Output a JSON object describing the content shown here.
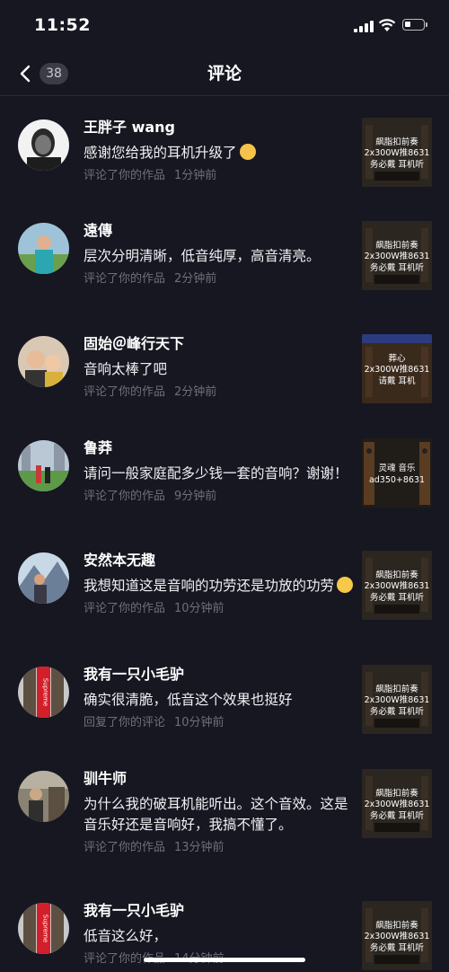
{
  "status_bar": {
    "time": "11:52"
  },
  "nav": {
    "title": "评论",
    "count": "38"
  },
  "comments": [
    {
      "username": "王胖子 wang",
      "text": "感谢您给我的耳机升级了",
      "emoji": "thinking-face",
      "meta_action": "评论了你的作品",
      "time": "1分钟前",
      "thumb_lines": [
        "飙脂扣前奏",
        "2x300W推8631",
        "务必戴  耳机听"
      ]
    },
    {
      "username": "遠傳",
      "text": "层次分明清晰，低音纯厚，高音清亮。",
      "emoji": "",
      "meta_action": "评论了你的作品",
      "time": "2分钟前",
      "thumb_lines": [
        "飙脂扣前奏",
        "2x300W推8631",
        "务必戴  耳机听"
      ]
    },
    {
      "username": "固始＠峰行天下",
      "text": "音响太棒了吧",
      "emoji": "",
      "meta_action": "评论了你的作品",
      "time": "2分钟前",
      "thumb_lines": [
        "葬心",
        "2x300W推8631",
        "请戴  耳机"
      ]
    },
    {
      "username": "鲁莽",
      "text": "请问一般家庭配多少钱一套的音响？谢谢！",
      "emoji": "",
      "meta_action": "评论了你的作品",
      "time": "9分钟前",
      "thumb_lines": [
        "灵魂  音乐",
        "ad350+8631"
      ]
    },
    {
      "username": "安然本无趣",
      "text": "我想知道这是音响的功劳还是功放的功劳",
      "emoji": "laughing-face",
      "meta_action": "评论了你的作品",
      "time": "10分钟前",
      "thumb_lines": [
        "飙脂扣前奏",
        "2x300W推8631",
        "务必戴  耳机听"
      ]
    },
    {
      "username": "我有一只小毛驴",
      "text": "确实很清脆，低音这个效果也挺好",
      "emoji": "",
      "meta_action": "回复了你的评论",
      "time": "10分钟前",
      "thumb_lines": [
        "飙脂扣前奏",
        "2x300W推8631",
        "务必戴  耳机听"
      ]
    },
    {
      "username": "驯牛师",
      "text": "为什么我的破耳机能听出。这个音效。这是音乐好还是音响好，我搞不懂了。",
      "emoji": "",
      "meta_action": "评论了你的作品",
      "time": "13分钟前",
      "thumb_lines": [
        "飙脂扣前奏",
        "2x300W推8631",
        "务必戴  耳机听"
      ]
    },
    {
      "username": "我有一只小毛驴",
      "text": "低音这么好，",
      "emoji": "",
      "meta_action": "评论了你的作品",
      "time": "14分钟前",
      "thumb_lines": [
        "飙脂扣前奏",
        "2x300W推8631",
        "务必戴  耳机听"
      ]
    }
  ],
  "avatar_text": {
    "supreme": "Supreme"
  },
  "colors": {
    "background": "#161721",
    "meta": "#6e6f7a",
    "badge": "#3b3c46"
  }
}
